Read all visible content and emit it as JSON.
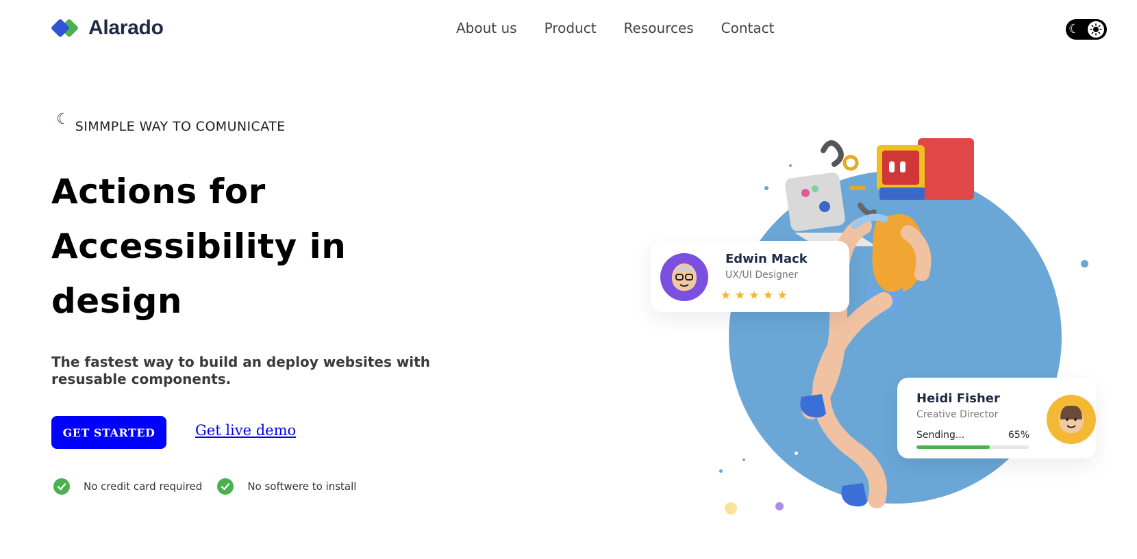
{
  "brand": {
    "name": "Alarado"
  },
  "nav": {
    "items": [
      {
        "label": "About us"
      },
      {
        "label": "Product"
      },
      {
        "label": "Resources"
      },
      {
        "label": "Contact"
      }
    ]
  },
  "theme_toggle": {
    "icons": [
      "moon-icon",
      "sun-icon"
    ]
  },
  "hero": {
    "eyebrow": "SIMMPLE WAY TO COMUNICATE",
    "title": "Actions for Accessibility in design",
    "subtitle": "The fastest way to build an deploy websites with resusable components.",
    "cta_primary": "GET STARTED",
    "cta_secondary": "Get live demo",
    "features": [
      {
        "label": "No credit card required",
        "icon": "check-icon"
      },
      {
        "label": "No softwere to install",
        "icon": "check-icon"
      }
    ]
  },
  "illustration": {
    "colors": {
      "circle": "#6aa6d6",
      "progress": "#4caf50",
      "stars": "#f4b531"
    },
    "profile_card": {
      "name": "Edwin Mack",
      "role": "UX/UI Designer",
      "rating": 5,
      "stars_display": "★ ★ ★ ★ ★"
    },
    "status_card": {
      "name": "Heidi Fisher",
      "role": "Creative Director",
      "status": "Sending...",
      "progress_label": "65%",
      "progress": 0.65
    }
  }
}
